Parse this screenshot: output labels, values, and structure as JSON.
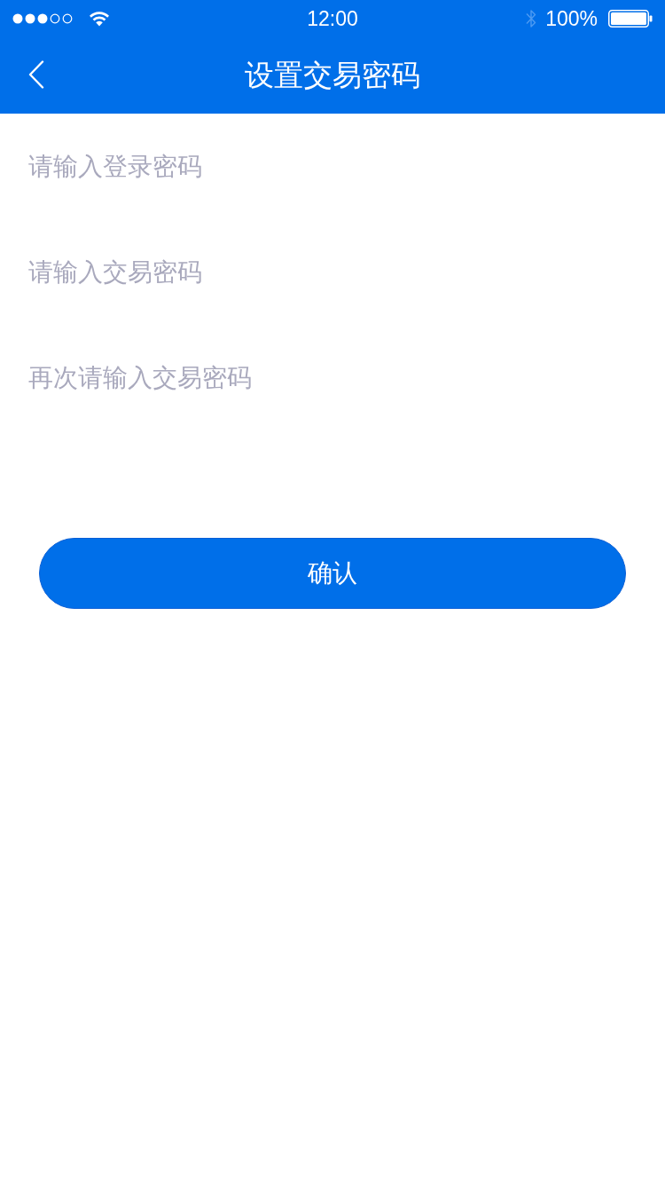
{
  "status_bar": {
    "time": "12:00",
    "battery": "100%"
  },
  "nav_bar": {
    "title": "设置交易密码"
  },
  "fields": [
    {
      "placeholder": "请输入登录密码"
    },
    {
      "placeholder": "请输入交易密码"
    },
    {
      "placeholder": "再次请输入交易密码"
    }
  ],
  "confirm_button": {
    "label": "确认"
  }
}
